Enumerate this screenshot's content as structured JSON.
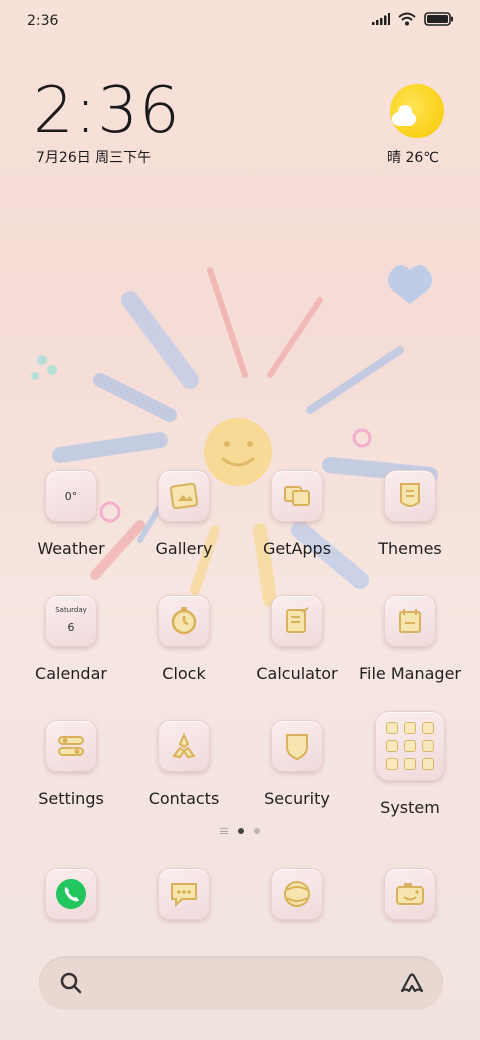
{
  "status_bar": {
    "time": "2:36"
  },
  "widget": {
    "clock": "2:36",
    "date": "7月26日 周三下午",
    "weather": "晴 26℃"
  },
  "apps": [
    {
      "label": "Weather",
      "icon": "weather-icon",
      "tile_text": "0°"
    },
    {
      "label": "Gallery",
      "icon": "gallery-icon"
    },
    {
      "label": "GetApps",
      "icon": "getapps-icon"
    },
    {
      "label": "Themes",
      "icon": "themes-icon"
    },
    {
      "label": "Calendar",
      "icon": "calendar-icon",
      "tile_day": "Saturday",
      "tile_num": "6"
    },
    {
      "label": "Clock",
      "icon": "clock-icon"
    },
    {
      "label": "Calculator",
      "icon": "calculator-icon"
    },
    {
      "label": "File Manager",
      "icon": "file-manager-icon"
    },
    {
      "label": "Settings",
      "icon": "settings-icon"
    },
    {
      "label": "Contacts",
      "icon": "contacts-icon"
    },
    {
      "label": "Security",
      "icon": "security-icon"
    },
    {
      "label": "System",
      "icon": "system-folder-icon"
    }
  ],
  "dock": [
    {
      "icon": "phone-icon"
    },
    {
      "icon": "messages-icon"
    },
    {
      "icon": "browser-icon"
    },
    {
      "icon": "camera-icon"
    }
  ],
  "page_indicator": {
    "pages": 2,
    "current": 1
  },
  "colors": {
    "accent_gold": "#e5c56a",
    "phone_green": "#22c55e",
    "sun_yellow": "#f9d21a"
  }
}
